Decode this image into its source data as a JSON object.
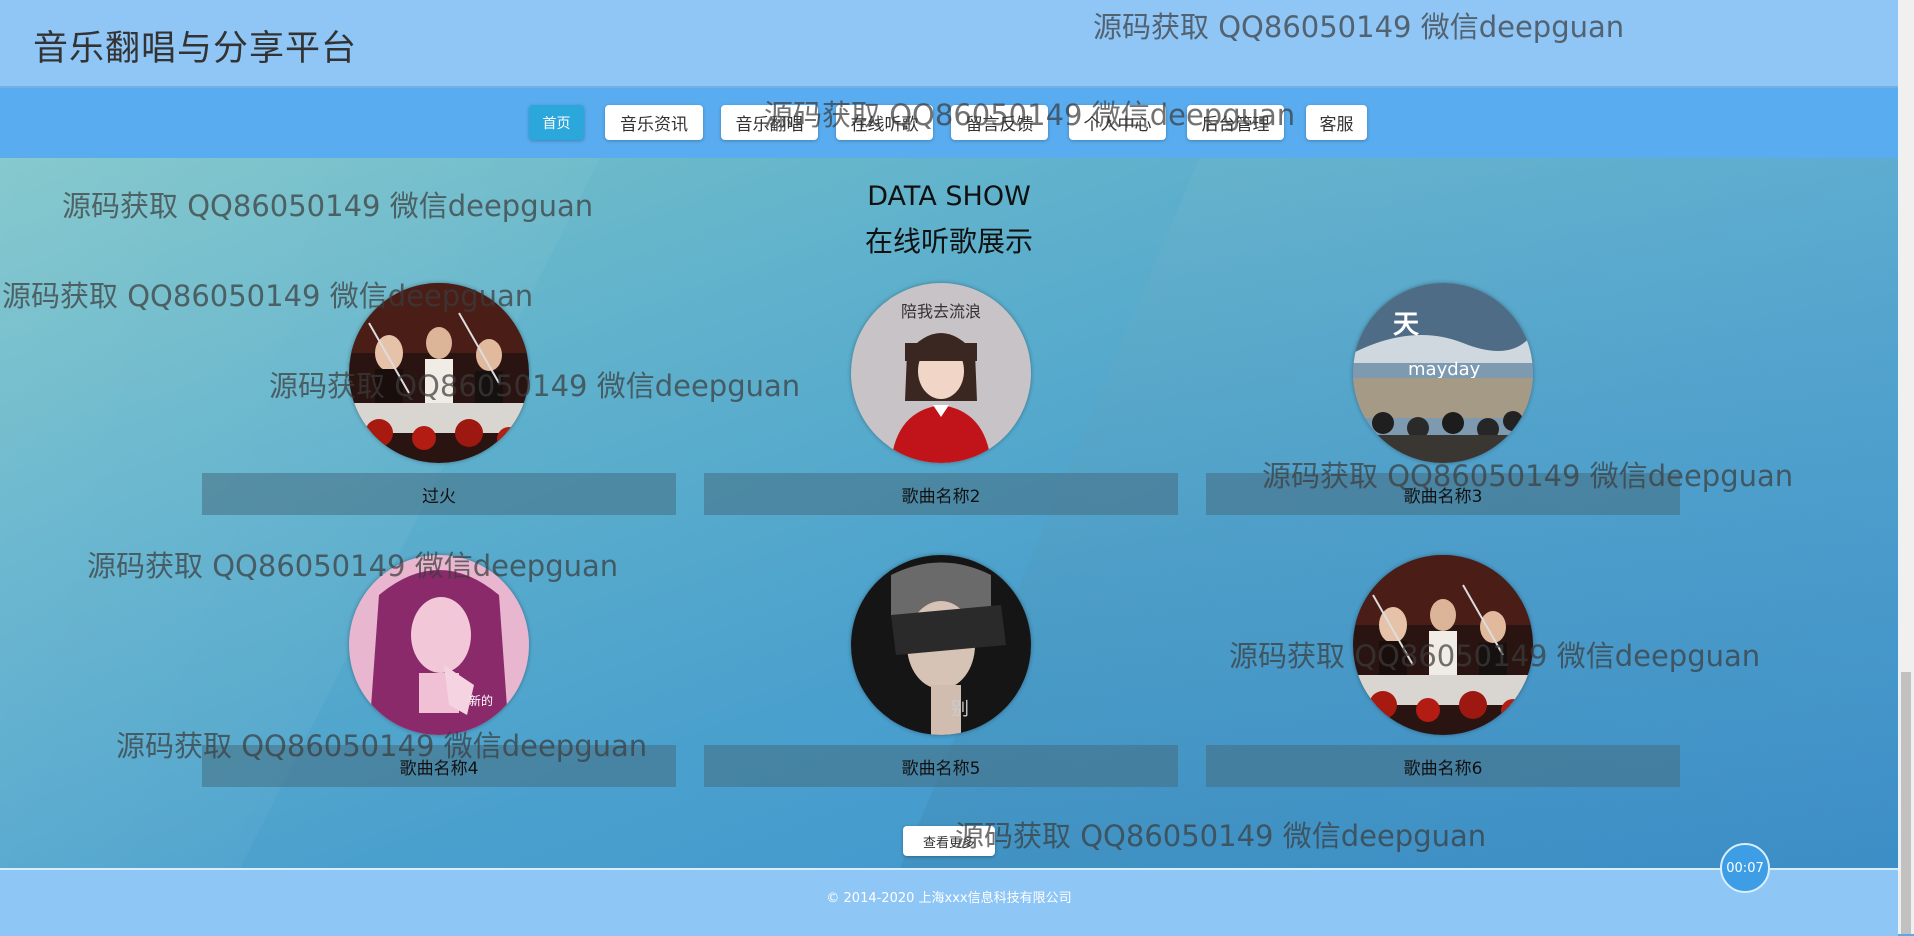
{
  "site": {
    "title": "音乐翻唱与分享平台"
  },
  "nav": {
    "items": [
      {
        "label": "首页"
      },
      {
        "label": "音乐资讯"
      },
      {
        "label": "音乐翻唱"
      },
      {
        "label": "在线听歌"
      },
      {
        "label": "留言反馈"
      },
      {
        "label": "个人中心"
      },
      {
        "label": "后台管理"
      },
      {
        "label": "客服"
      }
    ],
    "active_index": 0
  },
  "section": {
    "title_en": "DATA SHOW",
    "title_zh": "在线听歌展示"
  },
  "songs": [
    {
      "name": "过火",
      "cover": "band-drummers-cover"
    },
    {
      "name": "歌曲名称2",
      "cover": "girl-red-sweater-cover"
    },
    {
      "name": "歌曲名称3",
      "cover": "mayday-album-cover"
    },
    {
      "name": "歌曲名称4",
      "cover": "female-singer-pink-cover"
    },
    {
      "name": "歌曲名称5",
      "cover": "man-hand-over-eyes-cover"
    },
    {
      "name": "歌曲名称6",
      "cover": "band-drummers-cover"
    }
  ],
  "more_label": "查看更多",
  "footer": {
    "copyright": "© 2014-2020 上海xxx信息科技有限公司"
  },
  "player": {
    "time": "00:07"
  },
  "watermark": "源码获取 QQ86050149 微信deepguan",
  "colors": {
    "header": "#8fc6f6",
    "nav": "#58acef",
    "active": "#2ba7dc",
    "footer": "#8ec6f6"
  }
}
